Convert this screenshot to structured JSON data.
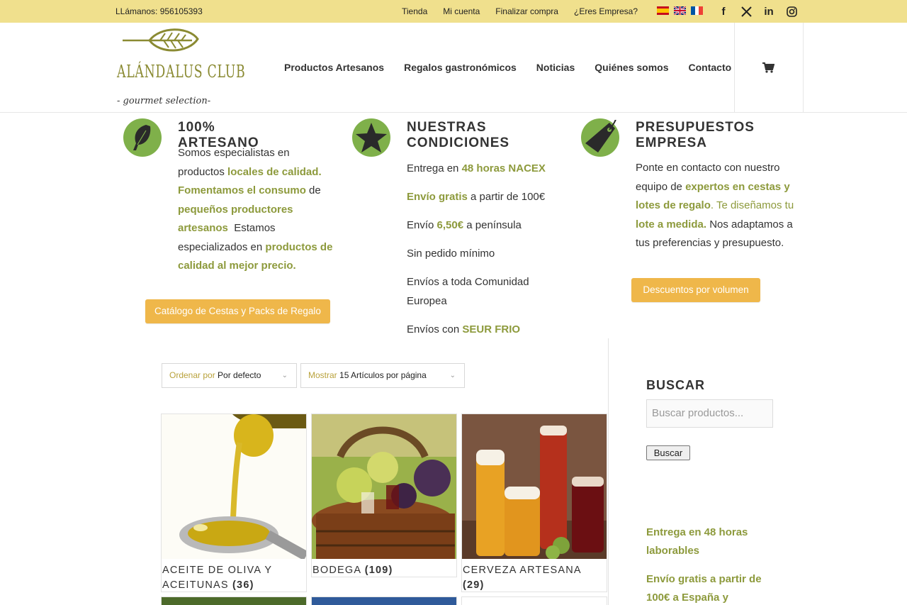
{
  "topbar": {
    "phone": "LLámanos: 956105393",
    "links": [
      "Tienda",
      "Mi cuenta",
      "Finalizar compra",
      "¿Eres Empresa?"
    ],
    "flags": [
      "spanish-flag-icon",
      "uk-flag-icon",
      "french-flag-icon"
    ],
    "socials": [
      {
        "icon": "facebook-icon",
        "glyph": "f"
      },
      {
        "icon": "x-twitter-icon",
        "glyph": "𝕏"
      },
      {
        "icon": "linkedin-icon",
        "glyph": "in"
      },
      {
        "icon": "instagram-icon",
        "glyph": ""
      }
    ]
  },
  "header": {
    "logo_name": "ALÁNDALUS CLUB",
    "logo_tagline": "- gourmet selection-",
    "nav": [
      "Productos Artesanos",
      "Regalos gastronómicos",
      "Noticias",
      "Quiénes somos",
      "Contacto"
    ]
  },
  "features": {
    "artesano": {
      "title": "100% ARTESANO",
      "p1": "Somos especialistas en",
      "p2a": "productos ",
      "p2b": "locales de calidad.",
      "p3a": "Fomentamos el consumo",
      "p3b": " de",
      "p4": "pequeños productores",
      "p5a": "artesanos",
      "p5b": "  Estamos",
      "p6a": "especializados en ",
      "p6b": "productos de",
      "p7": "calidad al mejor precio.",
      "button": "Catálogo de Cestas y Packs de Regalo"
    },
    "condiciones": {
      "title1": "NUESTRAS",
      "title2": "CONDICIONES",
      "c1a": "Entrega en ",
      "c1b": "48 horas NACEX",
      "c2a": "Envío gratis",
      "c2b": " a partir de 100€",
      "c3a": "Envío ",
      "c3b": "6,50€",
      "c3c": " a península",
      "c4": "Sin pedido mínimo",
      "c5a": "Envíos a toda Comunidad",
      "c5b": "Europea",
      "c6a": "Envíos con ",
      "c6b": "SEUR FRIO"
    },
    "empresa": {
      "title1": "PRESUPUESTOS",
      "title2": "EMPRESA",
      "l1": "Ponte en contacto con nuestro",
      "l2a": "equipo de ",
      "l2b": "expertos en cestas y",
      "l3a": "lotes de regalo",
      "l3b": ". Te diseñamos tu",
      "l4a": "lote a medida.",
      "l4b": " Nos adaptamos a",
      "l5": "tus preferencias y presupuesto.",
      "button": "Descuentos por volumen"
    }
  },
  "shop": {
    "orderby_label": "Ordenar por",
    "orderby_value": "Por defecto",
    "show_label": "Mostrar",
    "show_value": "15 Artículos por página",
    "categories": [
      {
        "name1": "ACEITE DE OLIVA Y",
        "name2": "ACEITUNAS",
        "count": "(36)"
      },
      {
        "name1": "BODEGA",
        "name2": "",
        "count": "(109)"
      },
      {
        "name1": "CERVEZA ARTESANA",
        "name2": "",
        "count": "(29)"
      }
    ]
  },
  "sidebar": {
    "search_title": "BUSCAR",
    "search_placeholder": "Buscar productos...",
    "search_button": "Buscar",
    "info1a": "Entrega en 48 horas",
    "info1b": "laborables",
    "info2a": "Envío gratis a partir de",
    "info2b": "100€ a España y"
  },
  "colors": {
    "topbar": "#f0e08d",
    "accent_text": "#8d9a3c",
    "button": "#efb74a",
    "icon_circle": "#7fb04a"
  }
}
